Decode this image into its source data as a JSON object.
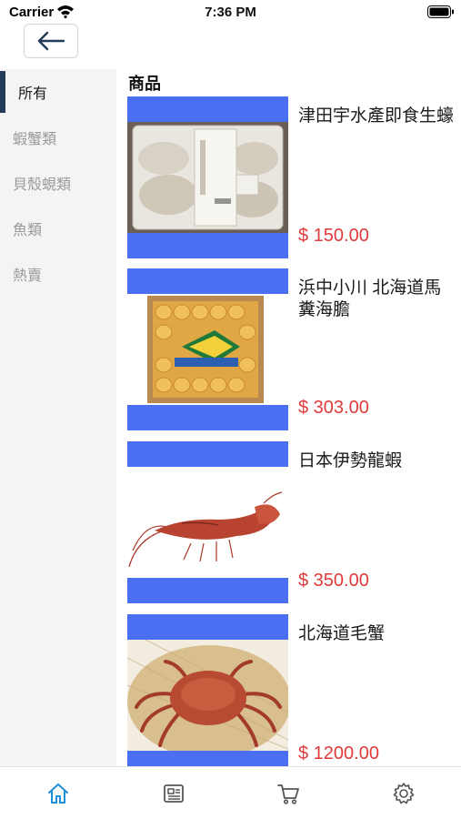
{
  "status_bar": {
    "carrier": "Carrier",
    "time": "7:36 PM"
  },
  "nav": {
    "back_icon": "arrow-left-icon"
  },
  "sidebar": {
    "items": [
      {
        "label": "所有",
        "active": true
      },
      {
        "label": "蝦蟹類",
        "active": false
      },
      {
        "label": "貝殼蜆類",
        "active": false
      },
      {
        "label": "魚類",
        "active": false
      },
      {
        "label": "熱賣",
        "active": false
      }
    ]
  },
  "main": {
    "title": "商品",
    "products": [
      {
        "name": "津田宇水產即食生蠔",
        "price": "$ 150.00"
      },
      {
        "name": "浜中小川 北海道馬糞海膽",
        "price": "$ 303.00"
      },
      {
        "name": "日本伊勢龍蝦",
        "price": "$ 350.00"
      },
      {
        "name": "北海道毛蟹",
        "price": "$ 1200.00"
      }
    ]
  },
  "tabbar": {
    "tabs": [
      {
        "icon": "home-icon",
        "active": true
      },
      {
        "icon": "news-icon",
        "active": false
      },
      {
        "icon": "cart-icon",
        "active": false
      },
      {
        "icon": "gear-icon",
        "active": false
      }
    ]
  },
  "colors": {
    "accent": "#1f8fe0",
    "price": "#e03a3a",
    "band": "#4a6ff0",
    "sidebar_bg": "#f4f4f4",
    "active_bar": "#243b5a"
  }
}
